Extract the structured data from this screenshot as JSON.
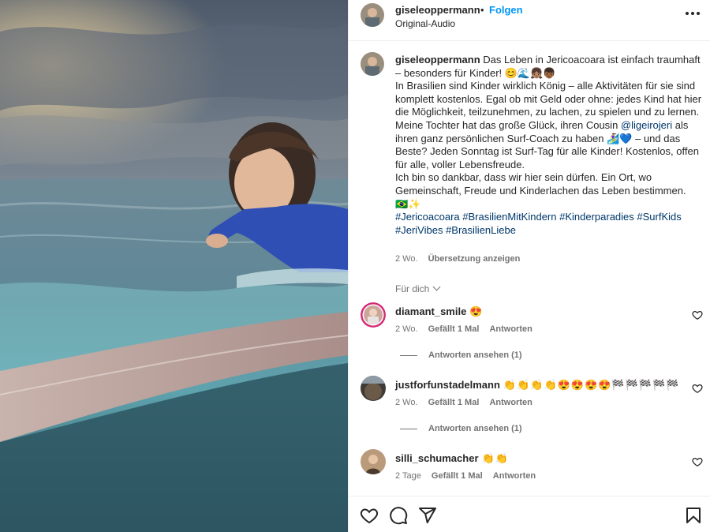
{
  "header": {
    "username": "giseleoppermann",
    "separator": "•",
    "follow_label": "Folgen",
    "audio_label": "Original-Audio",
    "more_icon": "more-horizontal-icon"
  },
  "caption": {
    "username": "giseleoppermann",
    "line1": "Das Leben in Jericoacoara ist einfach traumhaft – besonders für Kinder! 😊🌊👧🏽👦🏾",
    "line2": "In Brasilien sind Kinder wirklich König – alle Aktivitäten für sie sind komplett kostenlos. Egal ob mit Geld oder ohne: jedes Kind hat hier die Möglichkeit, teilzunehmen, zu lachen, zu spielen und zu lernen.",
    "line3_pre": "Meine Tochter hat das große Glück, ihren Cousin ",
    "mention": "@ligeirojeri",
    "line3_post": " als ihren ganz persönlichen Surf-Coach zu haben 🏄‍♀️💙 – und das Beste? Jeden Sonntag ist Surf-Tag für alle Kinder! Kostenlos, offen für alle, voller Lebensfreude.",
    "line4": "Ich bin so dankbar, dass wir hier sein dürfen. Ein Ort, wo Gemeinschaft, Freude und Kinderlachen das Leben bestimmen.",
    "line5": "🇧🇷✨",
    "hashtags": "#Jericoacoara #BrasilienMitKindern #Kinderparadies #SurfKids #JeriVibes #BrasilienLiebe",
    "time": "2 Wo.",
    "translate_label": "Übersetzung anzeigen"
  },
  "for_you_label": "Für dich",
  "comments": [
    {
      "username": "diamant_smile",
      "text": "😍",
      "time": "2 Wo.",
      "likes": "Gefällt 1 Mal",
      "reply_label": "Antworten",
      "view_replies": "Antworten ansehen (1)"
    },
    {
      "username": "justforfunstadelmann",
      "text": "👏👏👏👏😍😍😍😍🏁🏁🏁🏁🏁",
      "time": "2 Wo.",
      "likes": "Gefällt 1 Mal",
      "reply_label": "Antworten",
      "view_replies": "Antworten ansehen (1)"
    },
    {
      "username": "silli_schumacher",
      "text": "👏👏",
      "time": "2 Tage",
      "likes": "Gefällt 1 Mal",
      "reply_label": "Antworten"
    }
  ],
  "actions": {
    "like_icon": "heart-icon",
    "comment_icon": "comment-icon",
    "share_icon": "share-icon",
    "save_icon": "bookmark-icon"
  },
  "colors": {
    "accent": "#0095f6",
    "link": "#00376b",
    "secondary_text": "#737373"
  }
}
